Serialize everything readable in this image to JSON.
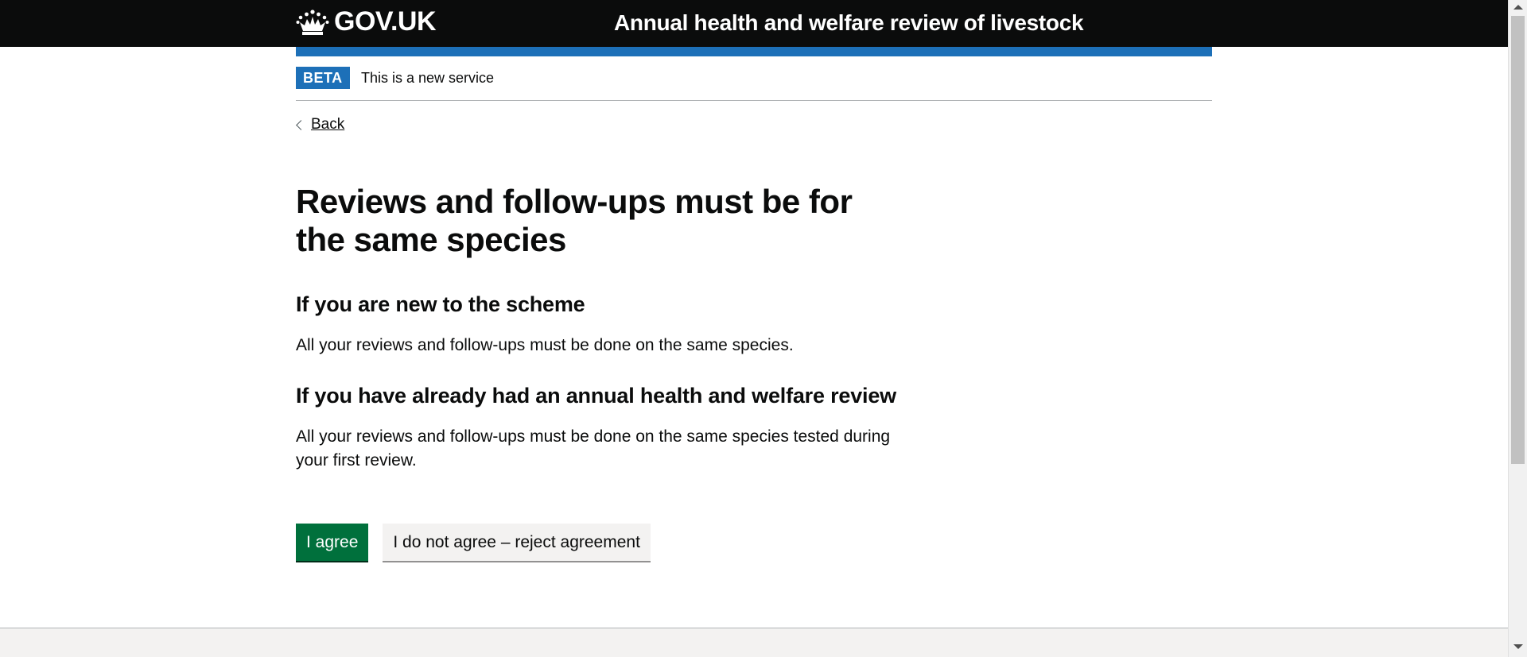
{
  "header": {
    "logo_text": "GOV.UK",
    "service_name": "Annual health and welfare review of livestock"
  },
  "phase_banner": {
    "tag": "BETA",
    "text": "This is a new service"
  },
  "back_link": "Back",
  "main": {
    "title": "Reviews and follow-ups must be for the same species",
    "sections": [
      {
        "heading": "If you are new to the scheme",
        "body": "All your reviews and follow-ups must be done on the same species."
      },
      {
        "heading": "If you have already had an annual health and welfare review",
        "body": "All your reviews and follow-ups must be done on the same species tested during your first review."
      }
    ],
    "agree_button": "I agree",
    "reject_button": "I do not agree – reject agreement"
  },
  "colors": {
    "header_bg": "#0b0c0c",
    "brand_blue": "#1d70b8",
    "primary_button": "#00703c",
    "secondary_button": "#f3f2f1"
  },
  "icons": {
    "logo": "crown-icon",
    "back": "chevron-left-icon"
  }
}
